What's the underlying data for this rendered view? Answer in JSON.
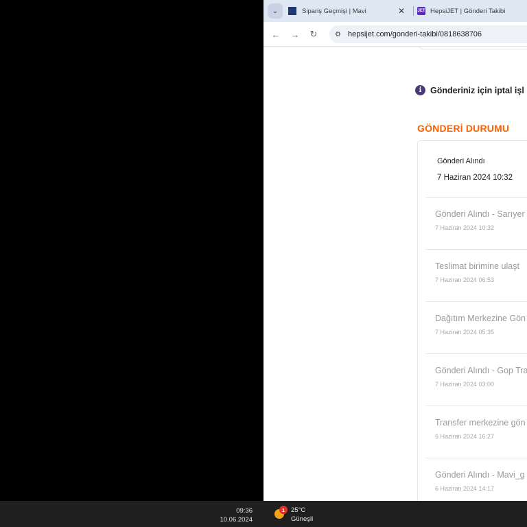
{
  "browser": {
    "tabs": [
      {
        "title": "Sipariş Geçmişi | Mavi",
        "favicon": "mavi-logo-icon",
        "active": true
      },
      {
        "title": "HepsiJET | Gönderi Takibi",
        "favicon": "hepsijet-logo-icon",
        "favicon_text": "JET",
        "active": false
      }
    ],
    "url": "hepsijet.com/gonderi-takibi/0818638706"
  },
  "page": {
    "info_text": "Gönderiniz için iptal işl",
    "section_title": "GÖNDERİ DURUMU",
    "current_status": {
      "label": "Gönderi Alındı",
      "date": "7 Haziran 2024 10:32"
    },
    "events": [
      {
        "title": "Gönderi Alındı - Sarıyer",
        "date": "7 Haziran 2024 10:32"
      },
      {
        "title": "Teslimat birimine ulaşt",
        "date": "7 Haziran 2024 06:53"
      },
      {
        "title": "Dağıtım Merkezine Gön",
        "date": "7 Haziran 2024 05:35"
      },
      {
        "title": "Gönderi Alındı - Gop Tra",
        "date": "7 Haziran 2024 03:00"
      },
      {
        "title": "Transfer merkezine gön",
        "date": "6 Haziran 2024 16:27"
      },
      {
        "title": "Gönderi Alındı - Mavi_g",
        "date": "6 Haziran 2024 14:17"
      }
    ]
  },
  "taskbar": {
    "time": "09:36",
    "date": "10.06.2024",
    "weather_temp": "25°C",
    "weather_desc": "Güneşli",
    "notification_count": "1"
  },
  "colors": {
    "accent_orange": "#ff6000",
    "info_icon": "#4a3a7a",
    "tabstrip": "#dfe7f3",
    "taskbar": "#1f1f1f"
  }
}
